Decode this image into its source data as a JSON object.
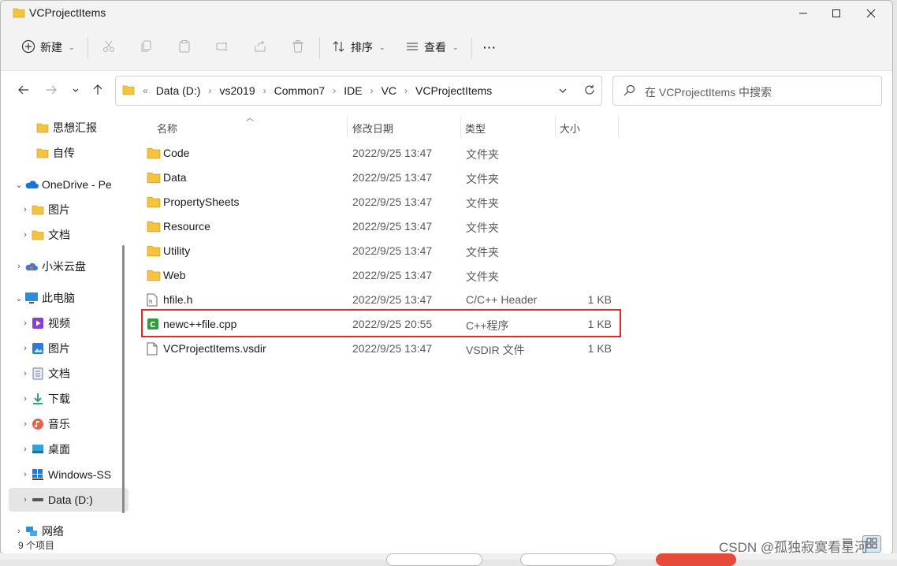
{
  "window": {
    "title": "VCProjectItems"
  },
  "toolbar": {
    "new_label": "新建",
    "sort_label": "排序",
    "view_label": "查看",
    "more_label": "···"
  },
  "address": {
    "crumbs": [
      "Data (D:)",
      "vs2019",
      "Common7",
      "IDE",
      "VC",
      "VCProjectItems"
    ],
    "overflow": "«"
  },
  "search": {
    "placeholder": "在 VCProjectItems 中搜索"
  },
  "sidebar": {
    "items": [
      {
        "label": "思想汇报",
        "icon": "folder-icon"
      },
      {
        "label": "自传",
        "icon": "folder-icon"
      },
      {
        "label": "OneDrive - Pe",
        "icon": "cloud-icon"
      },
      {
        "label": "图片",
        "icon": "folder-icon"
      },
      {
        "label": "文档",
        "icon": "folder-icon"
      },
      {
        "label": "小米云盘",
        "icon": "cloud-icon"
      },
      {
        "label": "此电脑",
        "icon": "pc-icon"
      },
      {
        "label": "视频",
        "icon": "video-icon"
      },
      {
        "label": "图片",
        "icon": "pictures-icon"
      },
      {
        "label": "文档",
        "icon": "documents-icon"
      },
      {
        "label": "下载",
        "icon": "download-icon"
      },
      {
        "label": "音乐",
        "icon": "music-icon"
      },
      {
        "label": "桌面",
        "icon": "desktop-icon"
      },
      {
        "label": "Windows-SS",
        "icon": "windows-drive-icon"
      },
      {
        "label": "Data (D:)",
        "icon": "drive-icon"
      },
      {
        "label": "网络",
        "icon": "network-icon"
      }
    ]
  },
  "columns": {
    "name": "名称",
    "date": "修改日期",
    "type": "类型",
    "size": "大小"
  },
  "files": [
    {
      "name": "Code",
      "date": "2022/9/25 13:47",
      "type": "文件夹",
      "size": "",
      "icon": "folder-icon"
    },
    {
      "name": "Data",
      "date": "2022/9/25 13:47",
      "type": "文件夹",
      "size": "",
      "icon": "folder-icon"
    },
    {
      "name": "PropertySheets",
      "date": "2022/9/25 13:47",
      "type": "文件夹",
      "size": "",
      "icon": "folder-icon"
    },
    {
      "name": "Resource",
      "date": "2022/9/25 13:47",
      "type": "文件夹",
      "size": "",
      "icon": "folder-icon"
    },
    {
      "name": "Utility",
      "date": "2022/9/25 13:47",
      "type": "文件夹",
      "size": "",
      "icon": "folder-icon"
    },
    {
      "name": "Web",
      "date": "2022/9/25 13:47",
      "type": "文件夹",
      "size": "",
      "icon": "folder-icon"
    },
    {
      "name": "hfile.h",
      "date": "2022/9/25 13:47",
      "type": "C/C++ Header",
      "size": "1 KB",
      "icon": "header-file-icon"
    },
    {
      "name": "newc++file.cpp",
      "date": "2022/9/25 20:55",
      "type": "C++程序",
      "size": "1 KB",
      "icon": "cpp-file-icon"
    },
    {
      "name": "VCProjectItems.vsdir",
      "date": "2022/9/25 13:47",
      "type": "VSDIR 文件",
      "size": "1 KB",
      "icon": "file-icon"
    }
  ],
  "status": {
    "count": "9 个项目"
  },
  "watermark": "CSDN @孤独寂寞看星河",
  "colors": {
    "folder": "#f4c441",
    "highlight": "#e0282e",
    "cpp": "#2e9d3a"
  }
}
